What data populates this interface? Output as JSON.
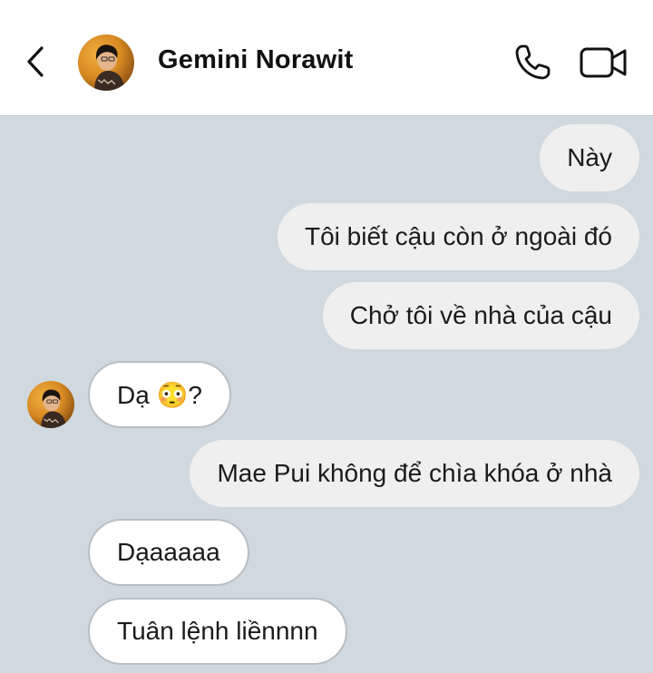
{
  "header": {
    "contact_name": "Gemini Norawit",
    "icons": [
      "chevron-left-icon",
      "phone-icon",
      "video-camera-icon"
    ]
  },
  "messages": [
    {
      "side": "sent",
      "text": "Này"
    },
    {
      "side": "sent",
      "text": "Tôi biết cậu còn ở ngoài đó"
    },
    {
      "side": "sent",
      "text": "Chở tôi về nhà của cậu"
    },
    {
      "side": "received",
      "text": "Dạ 😳?"
    },
    {
      "side": "sent",
      "text": "Mae Pui không để chìa khóa ở nhà"
    },
    {
      "side": "received",
      "text": "Dạaaaaa"
    },
    {
      "side": "received",
      "text": "Tuân lệnh liềnnnn"
    }
  ],
  "colors": {
    "header_bg": "#ffffff",
    "chat_bg": "#d0d9df",
    "sent_bubble": "#efefef",
    "received_bubble": "#ffffff",
    "received_border": "#b8bfc4",
    "text": "#1b1b1b"
  }
}
